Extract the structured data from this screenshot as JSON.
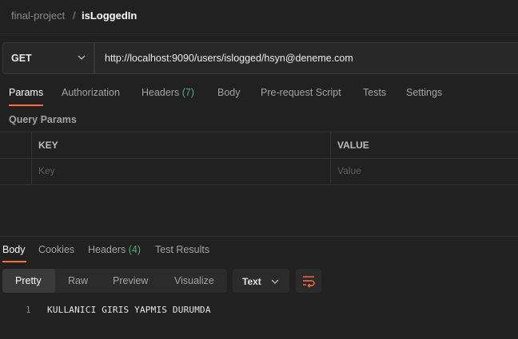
{
  "breadcrumb": {
    "collection": "final-project",
    "separator": "/",
    "request": "isLoggedIn"
  },
  "request": {
    "method": "GET",
    "url": "http://localhost:9090/users/islogged/hsyn@deneme.com"
  },
  "request_tabs": [
    {
      "label": "Params",
      "active": true
    },
    {
      "label": "Authorization"
    },
    {
      "label": "Headers",
      "count": "(7)"
    },
    {
      "label": "Body"
    },
    {
      "label": "Pre-request Script"
    },
    {
      "label": "Tests"
    },
    {
      "label": "Settings"
    }
  ],
  "query_params": {
    "title": "Query Params",
    "columns": [
      "KEY",
      "VALUE"
    ],
    "placeholders": {
      "key": "Key",
      "value": "Value"
    }
  },
  "response_tabs": [
    {
      "label": "Body",
      "active": true
    },
    {
      "label": "Cookies"
    },
    {
      "label": "Headers",
      "count": "(4)"
    },
    {
      "label": "Test Results"
    }
  ],
  "view_modes": [
    "Pretty",
    "Raw",
    "Preview",
    "Visualize"
  ],
  "format": "Text",
  "response_body": [
    {
      "line": "1",
      "text": "KULLANICI GIRIS YAPMIS DURUMDA"
    }
  ],
  "icons": {
    "method_dropdown": "chevron-down-icon",
    "format_dropdown": "chevron-down-icon",
    "wrap": "wrap-lines-icon"
  },
  "colors": {
    "accent": "#ff6c37",
    "badge": "#4caf7d",
    "background": "#212121"
  }
}
